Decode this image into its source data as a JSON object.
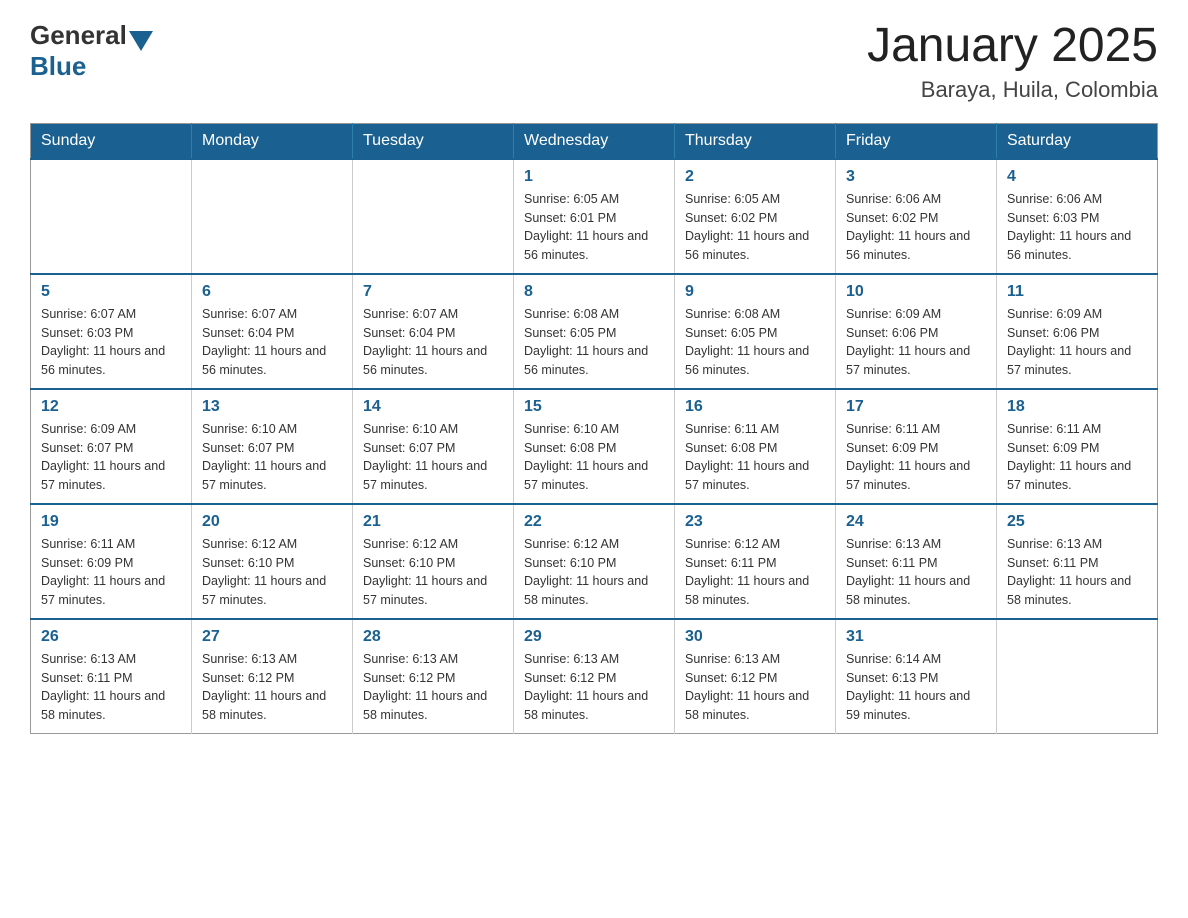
{
  "logo": {
    "general": "General",
    "blue": "Blue"
  },
  "title": "January 2025",
  "subtitle": "Baraya, Huila, Colombia",
  "weekdays": [
    "Sunday",
    "Monday",
    "Tuesday",
    "Wednesday",
    "Thursday",
    "Friday",
    "Saturday"
  ],
  "weeks": [
    [
      {
        "day": "",
        "info": ""
      },
      {
        "day": "",
        "info": ""
      },
      {
        "day": "",
        "info": ""
      },
      {
        "day": "1",
        "info": "Sunrise: 6:05 AM\nSunset: 6:01 PM\nDaylight: 11 hours and 56 minutes."
      },
      {
        "day": "2",
        "info": "Sunrise: 6:05 AM\nSunset: 6:02 PM\nDaylight: 11 hours and 56 minutes."
      },
      {
        "day": "3",
        "info": "Sunrise: 6:06 AM\nSunset: 6:02 PM\nDaylight: 11 hours and 56 minutes."
      },
      {
        "day": "4",
        "info": "Sunrise: 6:06 AM\nSunset: 6:03 PM\nDaylight: 11 hours and 56 minutes."
      }
    ],
    [
      {
        "day": "5",
        "info": "Sunrise: 6:07 AM\nSunset: 6:03 PM\nDaylight: 11 hours and 56 minutes."
      },
      {
        "day": "6",
        "info": "Sunrise: 6:07 AM\nSunset: 6:04 PM\nDaylight: 11 hours and 56 minutes."
      },
      {
        "day": "7",
        "info": "Sunrise: 6:07 AM\nSunset: 6:04 PM\nDaylight: 11 hours and 56 minutes."
      },
      {
        "day": "8",
        "info": "Sunrise: 6:08 AM\nSunset: 6:05 PM\nDaylight: 11 hours and 56 minutes."
      },
      {
        "day": "9",
        "info": "Sunrise: 6:08 AM\nSunset: 6:05 PM\nDaylight: 11 hours and 56 minutes."
      },
      {
        "day": "10",
        "info": "Sunrise: 6:09 AM\nSunset: 6:06 PM\nDaylight: 11 hours and 57 minutes."
      },
      {
        "day": "11",
        "info": "Sunrise: 6:09 AM\nSunset: 6:06 PM\nDaylight: 11 hours and 57 minutes."
      }
    ],
    [
      {
        "day": "12",
        "info": "Sunrise: 6:09 AM\nSunset: 6:07 PM\nDaylight: 11 hours and 57 minutes."
      },
      {
        "day": "13",
        "info": "Sunrise: 6:10 AM\nSunset: 6:07 PM\nDaylight: 11 hours and 57 minutes."
      },
      {
        "day": "14",
        "info": "Sunrise: 6:10 AM\nSunset: 6:07 PM\nDaylight: 11 hours and 57 minutes."
      },
      {
        "day": "15",
        "info": "Sunrise: 6:10 AM\nSunset: 6:08 PM\nDaylight: 11 hours and 57 minutes."
      },
      {
        "day": "16",
        "info": "Sunrise: 6:11 AM\nSunset: 6:08 PM\nDaylight: 11 hours and 57 minutes."
      },
      {
        "day": "17",
        "info": "Sunrise: 6:11 AM\nSunset: 6:09 PM\nDaylight: 11 hours and 57 minutes."
      },
      {
        "day": "18",
        "info": "Sunrise: 6:11 AM\nSunset: 6:09 PM\nDaylight: 11 hours and 57 minutes."
      }
    ],
    [
      {
        "day": "19",
        "info": "Sunrise: 6:11 AM\nSunset: 6:09 PM\nDaylight: 11 hours and 57 minutes."
      },
      {
        "day": "20",
        "info": "Sunrise: 6:12 AM\nSunset: 6:10 PM\nDaylight: 11 hours and 57 minutes."
      },
      {
        "day": "21",
        "info": "Sunrise: 6:12 AM\nSunset: 6:10 PM\nDaylight: 11 hours and 57 minutes."
      },
      {
        "day": "22",
        "info": "Sunrise: 6:12 AM\nSunset: 6:10 PM\nDaylight: 11 hours and 58 minutes."
      },
      {
        "day": "23",
        "info": "Sunrise: 6:12 AM\nSunset: 6:11 PM\nDaylight: 11 hours and 58 minutes."
      },
      {
        "day": "24",
        "info": "Sunrise: 6:13 AM\nSunset: 6:11 PM\nDaylight: 11 hours and 58 minutes."
      },
      {
        "day": "25",
        "info": "Sunrise: 6:13 AM\nSunset: 6:11 PM\nDaylight: 11 hours and 58 minutes."
      }
    ],
    [
      {
        "day": "26",
        "info": "Sunrise: 6:13 AM\nSunset: 6:11 PM\nDaylight: 11 hours and 58 minutes."
      },
      {
        "day": "27",
        "info": "Sunrise: 6:13 AM\nSunset: 6:12 PM\nDaylight: 11 hours and 58 minutes."
      },
      {
        "day": "28",
        "info": "Sunrise: 6:13 AM\nSunset: 6:12 PM\nDaylight: 11 hours and 58 minutes."
      },
      {
        "day": "29",
        "info": "Sunrise: 6:13 AM\nSunset: 6:12 PM\nDaylight: 11 hours and 58 minutes."
      },
      {
        "day": "30",
        "info": "Sunrise: 6:13 AM\nSunset: 6:12 PM\nDaylight: 11 hours and 58 minutes."
      },
      {
        "day": "31",
        "info": "Sunrise: 6:14 AM\nSunset: 6:13 PM\nDaylight: 11 hours and 59 minutes."
      },
      {
        "day": "",
        "info": ""
      }
    ]
  ]
}
